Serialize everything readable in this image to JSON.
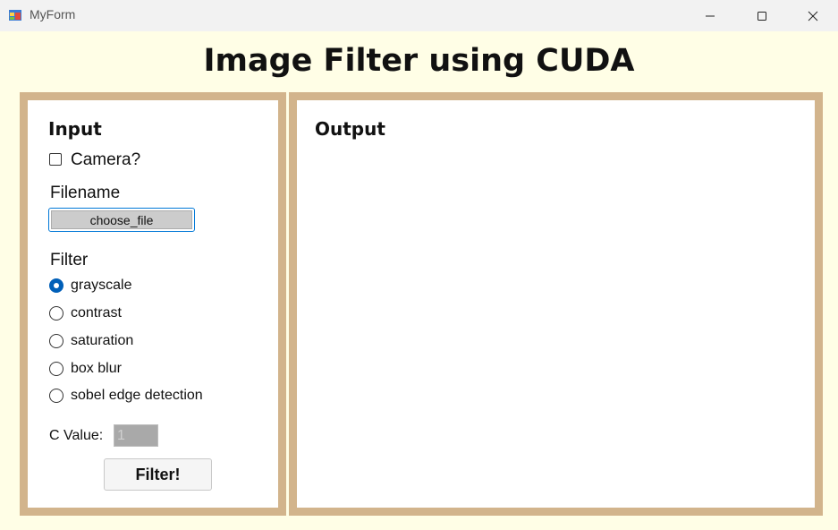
{
  "window": {
    "title": "MyForm"
  },
  "page": {
    "title": "Image Filter using CUDA"
  },
  "input_panel": {
    "heading": "Input",
    "camera_label": "Camera?",
    "camera_checked": false,
    "filename_label": "Filename",
    "choose_file_label": "choose_file",
    "filter_label": "Filter",
    "filters": [
      {
        "label": "grayscale",
        "checked": true
      },
      {
        "label": "contrast",
        "checked": false
      },
      {
        "label": "saturation",
        "checked": false
      },
      {
        "label": "box blur",
        "checked": false
      },
      {
        "label": "sobel edge detection",
        "checked": false
      }
    ],
    "c_value_label": "C Value:",
    "c_value": "1",
    "filter_button_label": "Filter!"
  },
  "output_panel": {
    "heading": "Output"
  },
  "colors": {
    "background": "#fffee6",
    "panel_border": "#d2b48c",
    "radio_accent": "#005fb8",
    "focus_border": "#0078d7"
  }
}
